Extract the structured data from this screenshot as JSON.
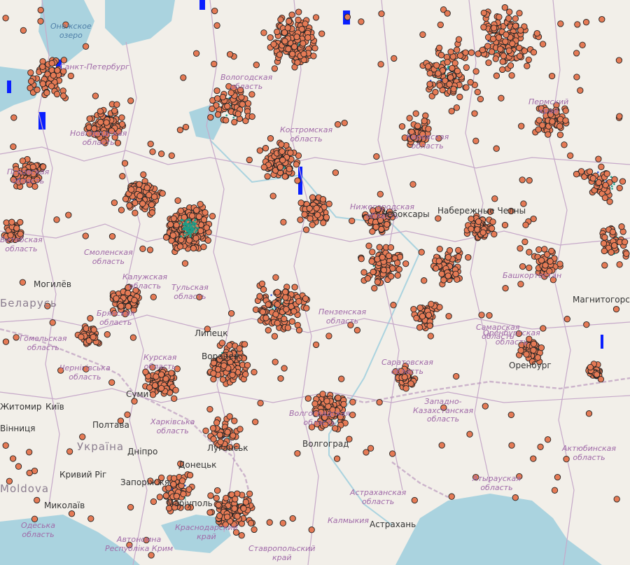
{
  "colors": {
    "land": "#f2efe9",
    "water": "#aad3df",
    "border": "#c6a9c9",
    "marker_fill": "#e57a55",
    "marker_stroke": "#222222",
    "cluster_teal": "#1e9c87",
    "lake_blue": "#0a1fff"
  },
  "labels": {
    "lake_onega": "Онежское\nозеро",
    "spb": "Санкт-Петербург",
    "vologda": "Вологодская\nобласть",
    "kostroma": "Костромская\nобласть",
    "novgorod": "Новгородская\nобласть",
    "pskov": "Псковская\nобласть",
    "kirov": "Кировская\nобласть",
    "perm": "Пермский\nкрай",
    "vitebsk": "Витебская\nобласть",
    "smolensk": "Смоленская\nобласть",
    "mogilev": "Могилёв",
    "belarus": "Беларусь",
    "kaluga": "Калужская\nобласть",
    "tula": "Тульская\nобласть",
    "bryansk": "Брянская\nобласть",
    "gomel": "Гомельская\nобласть",
    "chernihiv": "Чернігівська\nобласть",
    "kursk": "Курская\nобласть",
    "penza": "Пензенская\nобласть",
    "samara": "Самарская\nобласть",
    "nizhny": "Нижегородская\nобласть",
    "cheboksary": "Чебоксары",
    "naberezhnye": "Набережные Челны",
    "bashkortostan": "Башкортостан",
    "magnitogorsk": "Магнитогорск",
    "orenburg_obl": "Оренбургская\nобласть",
    "orenburg": "Оренбург",
    "lipetsk": "Липецк",
    "voronezh": "Воронеж",
    "saratov": "Саратовская\nобласть",
    "sumy": "Суми",
    "kyiv": "Київ",
    "zhytomyr": "Житомир",
    "poltava": "Полтава",
    "kharkiv": "Харківська\nобласть",
    "vinnytsia": "Вінниця",
    "ukraine": "Україна",
    "dnipro": "Дніпро",
    "luhansk": "Луганськ",
    "donetsk": "Донецьк",
    "kryvyi": "Кривий Ріг",
    "zaporizhzhia": "Запоріжжя",
    "moldova": "Moldova",
    "mykolaiv": "Миколаїв",
    "mariupol": "Маріуполь",
    "odesa": "Одеська\nобласть",
    "crimea": "Автономна\nРеспубліка Крим",
    "krasnodar": "Краснодарский\nкрай",
    "volgograd_obl": "Волгоградская\nобласть",
    "volgograd": "Волгоград",
    "w_kaz": "Западно-\nКазахстанская\nобласть",
    "aktobe": "Актюбинская\nобласть",
    "atyrau": "Атырауская\nобласть",
    "astrakhan_obl": "Астраханская\nобласть",
    "kalmykia": "Калмыкия",
    "astrakhan": "Астрахань",
    "stavropol": "Ставропольский\nкрай"
  }
}
